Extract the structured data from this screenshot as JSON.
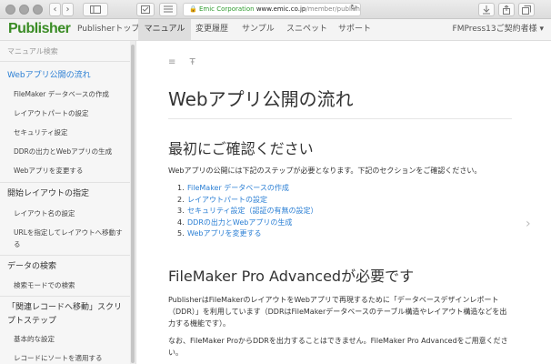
{
  "browser": {
    "address_lock": "🔒",
    "address_corp": "Emic Corporation",
    "address_host": "www.emic.co.jp",
    "address_path": "/member/publisher/manu",
    "reload_icon": "↻",
    "back_icon": "‹",
    "forward_icon": "›"
  },
  "site": {
    "logo": "Publisher",
    "nav": [
      {
        "label": "Publisherトップ"
      },
      {
        "label": "マニュアル"
      },
      {
        "label": "変更履歴"
      },
      {
        "label": "サンプル"
      },
      {
        "label": "スニペット"
      },
      {
        "label": "サポート"
      }
    ],
    "account": "FMPress13ご契約者様 ▾"
  },
  "sidebar": {
    "search": "マニュアル検索",
    "sections": [
      {
        "label": "Webアプリ公開の流れ",
        "items": [
          "FileMaker データベースの作成",
          "レイアウトパートの設定",
          "セキュリティ設定",
          "DDRの出力とWebアプリの生成",
          "Webアプリを変更する"
        ]
      },
      {
        "label": "開始レイアウトの指定",
        "items": [
          "レイアウト名の設定",
          "URLを指定してレイアウトへ移動する"
        ]
      },
      {
        "label": "データの検索",
        "items": [
          "検索モードでの検索"
        ]
      },
      {
        "label": "「関連レコードへ移動」スクリプトステップ",
        "items": [
          "基本的な設定",
          "レコードにソートを適用する"
        ]
      }
    ]
  },
  "main": {
    "toc_icon": "≡",
    "font_icon": "Ŧ",
    "title": "Webアプリ公開の流れ",
    "section1_title": "最初にご確認ください",
    "section1_intro": "Webアプリの公開には下記のステップが必要となります。下記のセクションをご確認ください。",
    "steps": [
      {
        "num": "1.",
        "label": "FileMaker データベースの作成"
      },
      {
        "num": "2.",
        "label": "レイアウトパートの設定"
      },
      {
        "num": "3.",
        "label": "セキュリティ設定（認証の有無の設定）"
      },
      {
        "num": "4.",
        "label": "DDRの出力とWebアプリの生成"
      },
      {
        "num": "5.",
        "label": "Webアプリを変更する"
      }
    ],
    "section2_title": "FileMaker Pro Advancedが必要です",
    "section2_p1": "PublisherはFileMakerのレイアウトをWebアプリで再現するために「データベースデザインレポート（DDR）」を利用しています（DDRはFileMakerデータベースのテーブル構造やレイアウト構造などを出力する機能です）。",
    "section2_p2": "なお、FileMaker ProからDDRを出力することはできません。FileMaker Pro Advancedをご用意ください。",
    "next_icon": "›"
  }
}
